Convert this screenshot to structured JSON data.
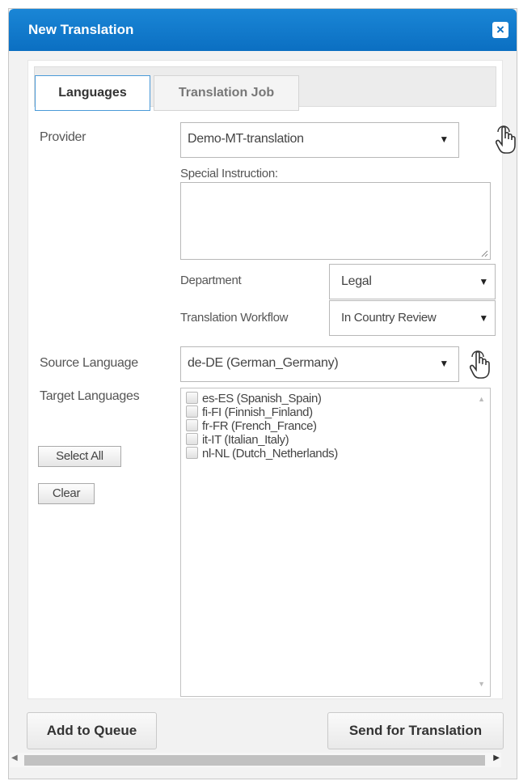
{
  "dialog": {
    "title": "New Translation",
    "close_symbol": "×"
  },
  "tabs": [
    {
      "label": "Languages",
      "active": true
    },
    {
      "label": "Translation Job",
      "active": false
    }
  ],
  "form": {
    "provider_label": "Provider",
    "provider_value": "Demo-MT-translation",
    "special_instruction_label": "Special Instruction:",
    "special_instruction_value": "",
    "department_label": "Department",
    "department_value": "Legal",
    "workflow_label": "Translation Workflow",
    "workflow_value": "In Country Review",
    "source_language_label": "Source Language",
    "source_language_value": "de-DE  (German_Germany)",
    "target_languages_label": "Target Languages",
    "target_languages": [
      {
        "label": "es-ES  (Spanish_Spain)",
        "checked": false
      },
      {
        "label": "fi-FI  (Finnish_Finland)",
        "checked": false
      },
      {
        "label": "fr-FR  (French_France)",
        "checked": false
      },
      {
        "label": "it-IT  (Italian_Italy)",
        "checked": false
      },
      {
        "label": "nl-NL  (Dutch_Netherlands)",
        "checked": false
      }
    ],
    "select_all_label": "Select All",
    "clear_label": "Clear"
  },
  "footer": {
    "add_to_queue_label": "Add to Queue",
    "send_label": "Send for Translation"
  },
  "icons": {
    "dropdown": "chevron-down-icon",
    "hand": "hand-pointer-icon",
    "close": "close-icon"
  },
  "colors": {
    "titlebar": "#0b6fc2",
    "active_tab_border": "#4a9ad8"
  }
}
